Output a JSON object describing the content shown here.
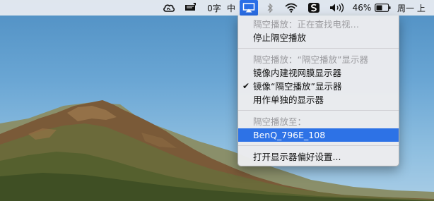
{
  "menubar": {
    "word_count_label": "0字",
    "input_method_label": "中",
    "battery_percent": "46%",
    "day_label": "周一 上"
  },
  "airplay_menu": {
    "status_label": "隔空播放：正在查找电视…",
    "stop_label": "停止隔空播放",
    "mode_header": "隔空播放：“隔空播放”显示器",
    "mirror_builtin_label": "镜像内建视网膜显示器",
    "mirror_airplay_label": "镜像“隔空播放”显示器",
    "mirror_airplay_checked": true,
    "separate_display_label": "用作单独的显示器",
    "target_header": "隔空播放至：",
    "device_label": "BenQ_796E_108",
    "prefs_label": "打开显示器偏好设置..."
  },
  "colors": {
    "highlight": "#2d72e6",
    "airplay_icon_bg": "#2a6ee6",
    "disabled_text": "#9a9a9e"
  },
  "icons": [
    "creative-cloud-icon",
    "notification-icon",
    "airplay-icon",
    "bluetooth-icon",
    "wifi-icon",
    "sogou-input-icon",
    "volume-icon",
    "battery-icon"
  ]
}
